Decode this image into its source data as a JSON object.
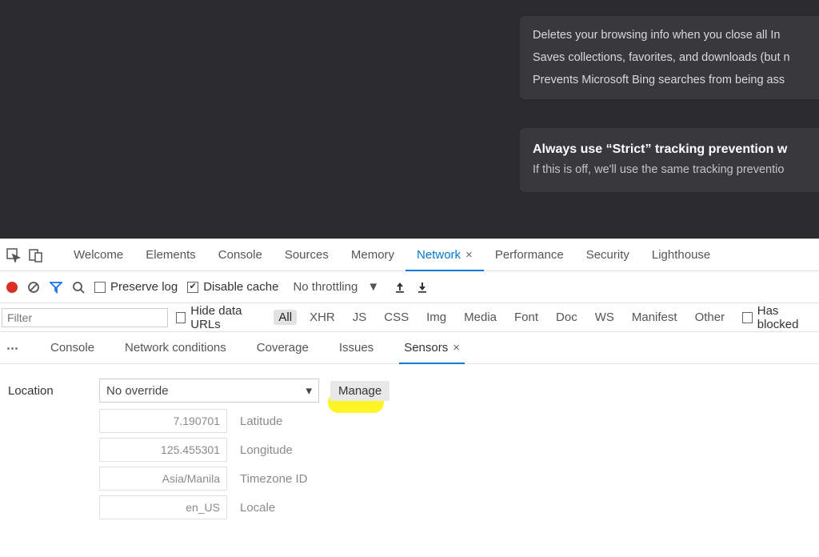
{
  "page": {
    "info_lines": [
      "Deletes your browsing info when you close all In",
      "Saves collections, favorites, and downloads (but n",
      "Prevents Microsoft Bing searches from being ass"
    ],
    "option_title": "Always use “Strict” tracking prevention w",
    "option_sub": "If this is off, we'll use the same tracking preventio"
  },
  "tabs": {
    "items": [
      "Welcome",
      "Elements",
      "Console",
      "Sources",
      "Memory",
      "Network",
      "Performance",
      "Security",
      "Lighthouse"
    ],
    "active": "Network"
  },
  "toolbar": {
    "preserve_log": "Preserve log",
    "preserve_checked": false,
    "disable_cache": "Disable cache",
    "disable_checked": true,
    "throttling": "No throttling"
  },
  "filter": {
    "placeholder": "Filter",
    "hide_data": "Hide data URLs",
    "chips": [
      "All",
      "XHR",
      "JS",
      "CSS",
      "Img",
      "Media",
      "Font",
      "Doc",
      "WS",
      "Manifest",
      "Other"
    ],
    "active_chip": "All",
    "has_blocked": "Has blocked"
  },
  "drawer": {
    "items": [
      "Console",
      "Network conditions",
      "Coverage",
      "Issues",
      "Sensors"
    ],
    "active": "Sensors"
  },
  "sensors": {
    "location_label": "Location",
    "location_value": "No override",
    "manage": "Manage",
    "fields": [
      {
        "value": "7.190701",
        "label": "Latitude"
      },
      {
        "value": "125.455301",
        "label": "Longitude"
      },
      {
        "value": "Asia/Manila",
        "label": "Timezone ID"
      },
      {
        "value": "en_US",
        "label": "Locale"
      }
    ]
  }
}
